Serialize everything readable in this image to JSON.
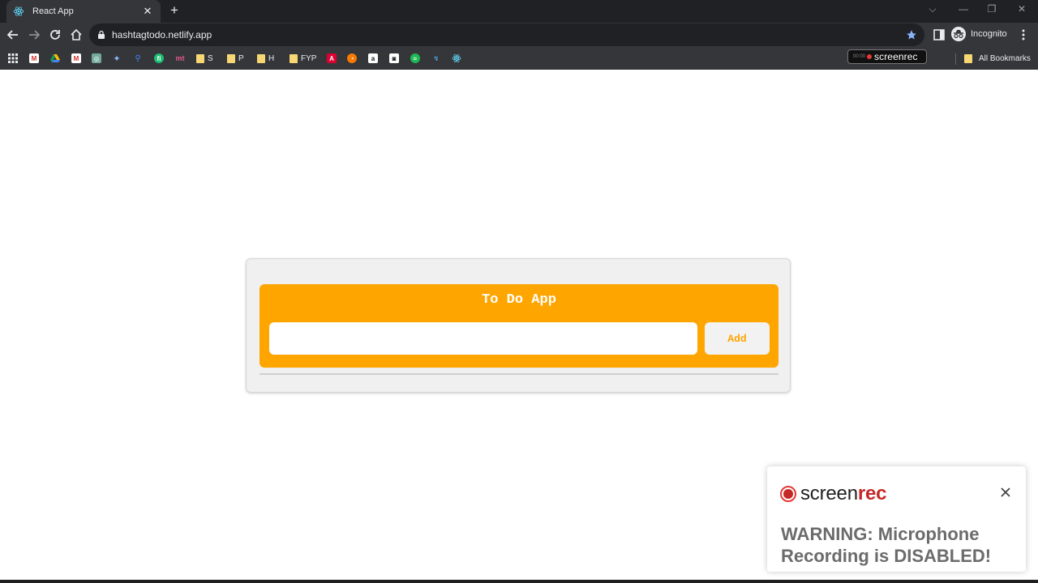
{
  "browser": {
    "tab_title": "React App",
    "url": "hashtagtodo.netlify.app",
    "profile_label": "Incognito",
    "bookmarks": [
      {
        "label": "S"
      },
      {
        "label": "P"
      },
      {
        "label": "H"
      },
      {
        "label": "FYP"
      }
    ],
    "screenrec_pill": "screenrec",
    "all_bookmarks": "All Bookmarks",
    "accent": "#8ab4f8"
  },
  "app": {
    "title": "To Do App",
    "input_value": "",
    "add_label": "Add",
    "accent": "#ffa500"
  },
  "popup": {
    "logo_part1": "screen",
    "logo_part2": "rec",
    "message": "WARNING: Microphone Recording is DISABLED!"
  }
}
